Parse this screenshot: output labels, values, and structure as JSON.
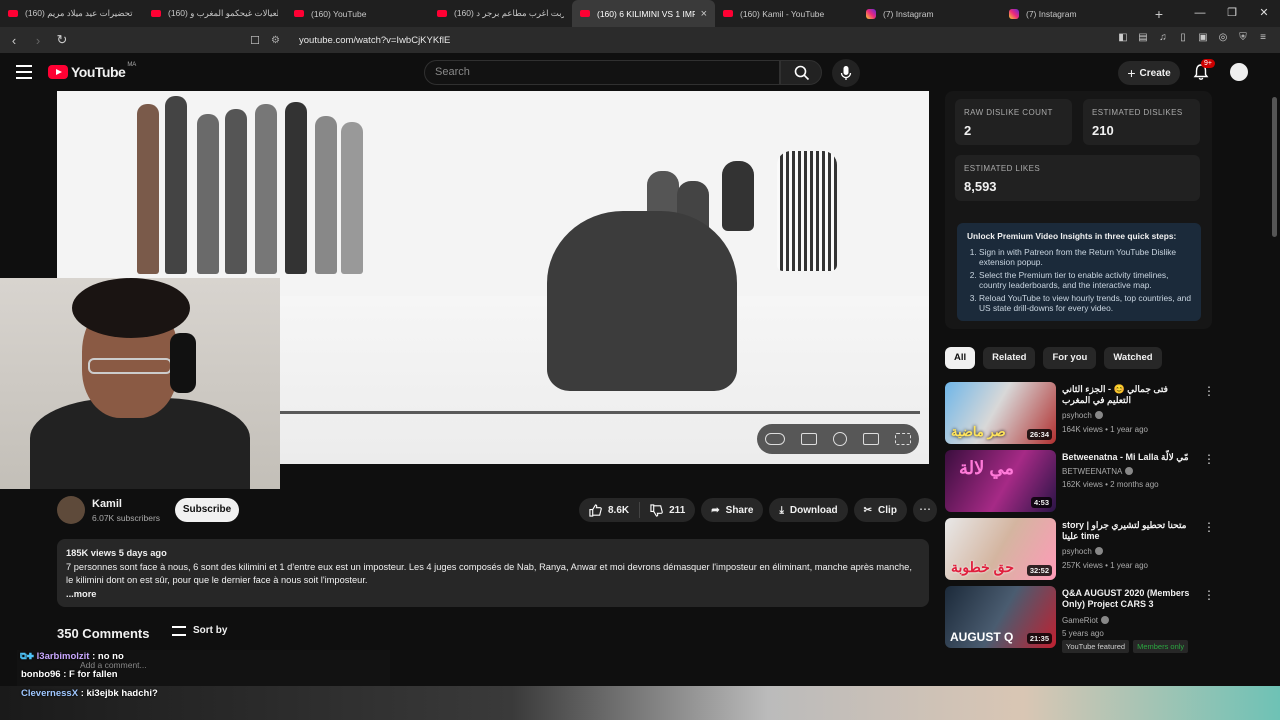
{
  "browser": {
    "tabs": [
      {
        "title": "(160) تحضيرات عيد ميلاد مريم",
        "icon": "youtube-favicon"
      },
      {
        "title": "(160) العيالات غيحكمو المغرب و",
        "icon": "youtube-favicon"
      },
      {
        "title": "(160) YouTube",
        "icon": "youtube-favicon"
      },
      {
        "title": "(160) جربت اغرب مطاعم برجر د",
        "icon": "youtube-favicon"
      },
      {
        "title": "(160) 6 KILIMINI VS 1 IMP",
        "icon": "youtube-favicon",
        "active": true
      },
      {
        "title": "(160) Kamil - YouTube",
        "icon": "youtube-favicon"
      },
      {
        "title": "(7) Instagram",
        "icon": "instagram-favicon"
      },
      {
        "title": "(7) Instagram",
        "icon": "instagram-favicon"
      }
    ],
    "url": "youtube.com/watch?v=IwbCjKYKflE",
    "new_tab_label": "+",
    "close_label": "×"
  },
  "youtube": {
    "logo_text": "YouTube",
    "country_code": "MA",
    "search_placeholder": "Search",
    "create_label": "Create",
    "notification_count": "9+"
  },
  "channel": {
    "name": "Kamil",
    "subscribers": "6.07K subscribers",
    "subscribe_label": "Subscribe"
  },
  "actions": {
    "likes": "8.6K",
    "dislikes": "211",
    "share": "Share",
    "download": "Download",
    "clip": "Clip",
    "more": "⋯"
  },
  "description": {
    "meta": "185K views  5 days ago",
    "text": "7 personnes sont face à nous, 6 sont des kilimini et 1 d'entre eux est un imposteur. Les 4 juges composés de Nab, Ranya, Anwar et moi devrons démasquer l'imposteur en éliminant, manche après manche, le kilimini dont on est sûr, pour que le dernier face à nous soit l'imposteur.",
    "more_label": "...more"
  },
  "comments": {
    "count_label": "350 Comments",
    "sort_label": "Sort by",
    "add_placeholder": "Add a comment..."
  },
  "chat": [
    {
      "user": "l3arbimolzit",
      "message": ": no no"
    },
    {
      "user": "bonbo96",
      "message": ": F for fallen"
    },
    {
      "user": "ClevernessX",
      "message": ": ki3ejbk hadchi?"
    }
  ],
  "dislike_panel": {
    "raw_label": "RAW DISLIKE COUNT",
    "raw_value": "2",
    "est_dislikes_label": "ESTIMATED DISLIKES",
    "est_dislikes_value": "210",
    "est_likes_label": "ESTIMATED LIKES",
    "est_likes_value": "8,593",
    "premium_title": "Unlock Premium Video Insights in three quick steps:",
    "steps": [
      "Sign in with Patreon from the Return YouTube Dislike extension popup.",
      "Select the Premium tier to enable activity timelines, country leaderboards, and the interactive map.",
      "Reload YouTube to view hourly trends, top countries, and US state drill-downs for every video."
    ]
  },
  "filter_chips": [
    "All",
    "Related",
    "For you",
    "Watched"
  ],
  "recommendations": [
    {
      "title": "فتى جمالي 😊 - الجزء الثاني التعليم في المغرب",
      "channel": "psyhoch",
      "views": "164K views • 1 year ago",
      "duration": "26:34",
      "thumb_text": "صر ماضية"
    },
    {
      "title": "Betweenatna - Mi Lalla مّي لالّة",
      "channel": "BETWEENATNA",
      "views": "162K views • 2 months ago",
      "duration": "4:53",
      "thumb_text": "مي لالة"
    },
    {
      "title": "story | متحنا تحطيو لتشيري جراو عليتا time",
      "channel": "psyhoch",
      "views": "257K views • 1 year ago",
      "duration": "32:52",
      "thumb_text": "حق خطوبة"
    },
    {
      "title": "Q&A AUGUST 2020 (Members Only) Project CARS 3",
      "channel": "GameRiot",
      "views": "5 years ago",
      "duration": "21:35",
      "thumb_text": "AUGUST Q",
      "badge1": "YouTube featured",
      "badge2": "Members only"
    }
  ]
}
